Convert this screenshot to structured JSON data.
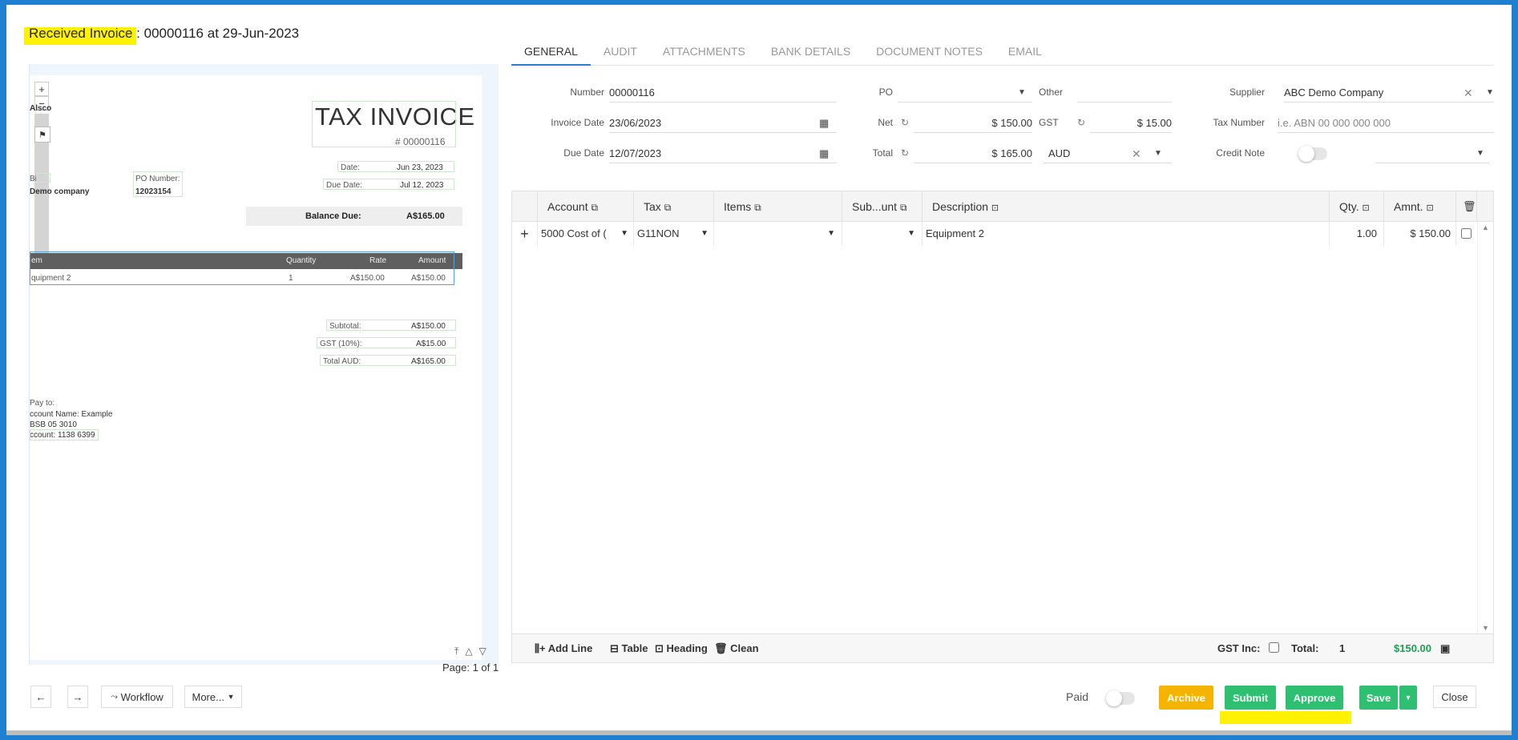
{
  "title": {
    "prefix": "Received Invoice :",
    "number": "00000116",
    "date_text": "at 29-Jun-2023"
  },
  "viewer": {
    "zoom_in": "+",
    "zoom_out": "−",
    "doc": {
      "tax_title": "TAX INVOICE",
      "tax_number": "# 00000116",
      "company_short": "Alsco",
      "bill_label": "Bi",
      "bill_company": "Demo company",
      "po_label": "PO Number:",
      "po_value": "12023154",
      "date_label": "Date:",
      "date_value": "Jun 23, 2023",
      "due_label": "Due Date:",
      "due_value": "Jul 12, 2023",
      "balance_label": "Balance Due:",
      "balance_value": "A$165.00",
      "col_item": "em",
      "col_qty": "Quantity",
      "col_rate": "Rate",
      "col_amount": "Amount",
      "row_item": "quipment 2",
      "row_qty": "1",
      "row_rate": "A$150.00",
      "row_amount": "A$150.00",
      "subtotal_label": "Subtotal:",
      "subtotal_value": "A$150.00",
      "gst_label": "GST (10%):",
      "gst_value": "A$15.00",
      "total_label": "Total AUD:",
      "total_value": "A$165.00",
      "payto_label": "Pay to:",
      "payto_name": "ccount Name: Example",
      "payto_bsb": "BSB 05 3010",
      "payto_acct": "ccount: 1138 6399"
    },
    "page_label": "Page: 1 of 1"
  },
  "tabs": [
    "GENERAL",
    "AUDIT",
    "ATTACHMENTS",
    "BANK DETAILS",
    "DOCUMENT NOTES",
    "EMAIL"
  ],
  "form": {
    "number_label": "Number",
    "number_value": "00000116",
    "invoice_date_label": "Invoice Date",
    "invoice_date_value": "23/06/2023",
    "due_date_label": "Due Date",
    "due_date_value": "12/07/2023",
    "po_label": "PO",
    "po_value": "",
    "net_label": "Net",
    "net_value": "$ 150.00",
    "total_label": "Total",
    "total_value": "$ 165.00",
    "other_label": "Other",
    "other_value": "",
    "gst_label": "GST",
    "gst_value": "$ 15.00",
    "currency_value": "AUD",
    "supplier_label": "Supplier",
    "supplier_value": "ABC Demo Company",
    "tax_number_label": "Tax Number",
    "tax_number_placeholder": "i.e. ABN 00 000 000 000",
    "credit_note_label": "Credit Note"
  },
  "grid": {
    "headers": [
      "Account",
      "Tax",
      "Items",
      "Sub...unt",
      "Description",
      "Qty.",
      "Amnt."
    ],
    "rows": [
      {
        "account": "5000 Cost of (",
        "tax": "G11NON",
        "items": "",
        "sub": "",
        "description": "Equipment 2",
        "qty": "1.00",
        "amount": "$ 150.00"
      }
    ],
    "footer": {
      "add_line": "Add Line",
      "table": "Table",
      "heading": "Heading",
      "clean": "Clean",
      "gst_inc": "GST Inc:",
      "total_label": "Total:",
      "total_count": "1",
      "total_amount": "$150.00"
    }
  },
  "bottom": {
    "workflow": "Workflow",
    "more": "More...",
    "paid": "Paid",
    "archive": "Archive",
    "submit": "Submit",
    "approve": "Approve",
    "save": "Save",
    "close": "Close"
  },
  "colors": {
    "accent": "#2a7bd2",
    "green": "#2fbf71",
    "archive": "#f5b400",
    "highlight": "#fff200",
    "total_green": "#1f9d55"
  }
}
